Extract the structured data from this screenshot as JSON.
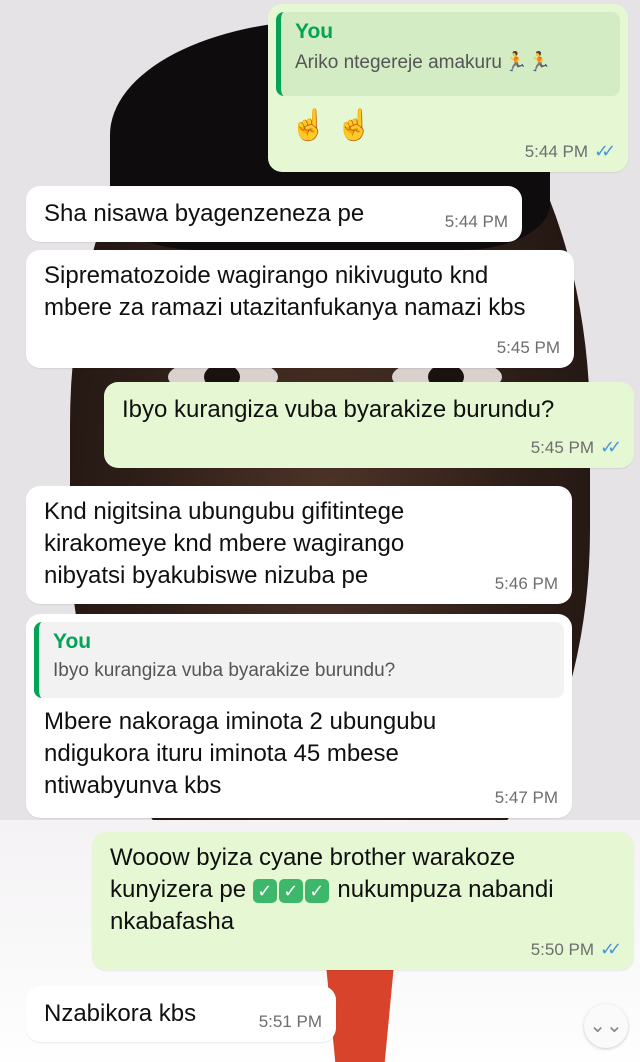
{
  "messages": [
    {
      "sender": "You",
      "quote_text": "Ariko ntegereje amakuru",
      "quote_emoji": "🏃🏃",
      "emoji": "☝️ ☝️",
      "time": "5:44 PM",
      "ticks": "✓✓"
    },
    {
      "text": "Sha nisawa byagenzeneza pe",
      "time": "5:44 PM"
    },
    {
      "text": "Sipremato­zoide wagirango nikivuguto knd mbere za ramazi utazitanfukanya namazi kbs",
      "time": "5:45 PM"
    },
    {
      "text": "Ibyo kurangiza vuba byarakize burundu?",
      "time": "5:45 PM",
      "ticks": "✓✓"
    },
    {
      "text": "Knd nigitsina ubungubu gifitintege kirakomeye knd mbere wagirango nibyatsi byakubiswe nizuba pe",
      "time": "5:46 PM"
    },
    {
      "quote_name": "You",
      "quote_text": "Ibyo kurangiza vuba byarakize burundu?",
      "text": "Mbere nakoraga iminota 2  ubungubu ndigukora ituru iminota 45 mbese ntiwabyunva kbs",
      "time": "5:47 PM"
    },
    {
      "text_a": "Wooow byiza cyane brother warakoze kunyizera pe",
      "check_glyph": "✓",
      "text_b": "nukumpuza nabandi nkabafasha",
      "time": "5:50 PM",
      "ticks": "✓✓"
    },
    {
      "text": "Nzabikora kbs",
      "time": "5:51 PM"
    }
  ],
  "scroll_icon": "double-chevron-down-icon",
  "scroll_glyph": "⌄⌄"
}
